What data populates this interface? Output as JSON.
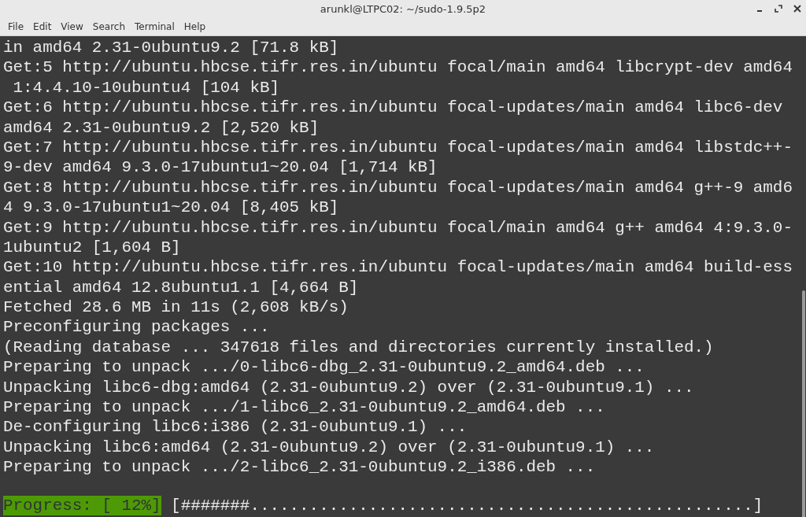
{
  "window": {
    "title": "arunkl@LTPC02: ~/sudo-1.9.5p2"
  },
  "menu": [
    "File",
    "Edit",
    "View",
    "Search",
    "Terminal",
    "Help"
  ],
  "terminal": {
    "lines": [
      "in amd64 2.31-0ubuntu9.2 [71.8 kB]",
      "Get:5 http://ubuntu.hbcse.tifr.res.in/ubuntu focal/main amd64 libcrypt-dev amd64",
      " 1:4.4.10-10ubuntu4 [104 kB]",
      "Get:6 http://ubuntu.hbcse.tifr.res.in/ubuntu focal-updates/main amd64 libc6-dev",
      "amd64 2.31-0ubuntu9.2 [2,520 kB]",
      "Get:7 http://ubuntu.hbcse.tifr.res.in/ubuntu focal-updates/main amd64 libstdc++-",
      "9-dev amd64 9.3.0-17ubuntu1~20.04 [1,714 kB]",
      "Get:8 http://ubuntu.hbcse.tifr.res.in/ubuntu focal-updates/main amd64 g++-9 amd6",
      "4 9.3.0-17ubuntu1~20.04 [8,405 kB]",
      "Get:9 http://ubuntu.hbcse.tifr.res.in/ubuntu focal/main amd64 g++ amd64 4:9.3.0-",
      "1ubuntu2 [1,604 B]",
      "Get:10 http://ubuntu.hbcse.tifr.res.in/ubuntu focal-updates/main amd64 build-ess",
      "ential amd64 12.8ubuntu1.1 [4,664 B]",
      "Fetched 28.6 MB in 11s (2,608 kB/s)",
      "Preconfiguring packages ...",
      "(Reading database ... 347618 files and directories currently installed.)",
      "Preparing to unpack .../0-libc6-dbg_2.31-0ubuntu9.2_amd64.deb ...",
      "Unpacking libc6-dbg:amd64 (2.31-0ubuntu9.2) over (2.31-0ubuntu9.1) ...",
      "Preparing to unpack .../1-libc6_2.31-0ubuntu9.2_amd64.deb ...",
      "De-configuring libc6:i386 (2.31-0ubuntu9.1) ...",
      "Unpacking libc6:amd64 (2.31-0ubuntu9.2) over (2.31-0ubuntu9.1) ...",
      "Preparing to unpack .../2-libc6_2.31-0ubuntu9.2_i386.deb ..."
    ],
    "progress": {
      "label": "Progress: [ 12%]",
      "bar": "[#######...................................................]"
    }
  }
}
